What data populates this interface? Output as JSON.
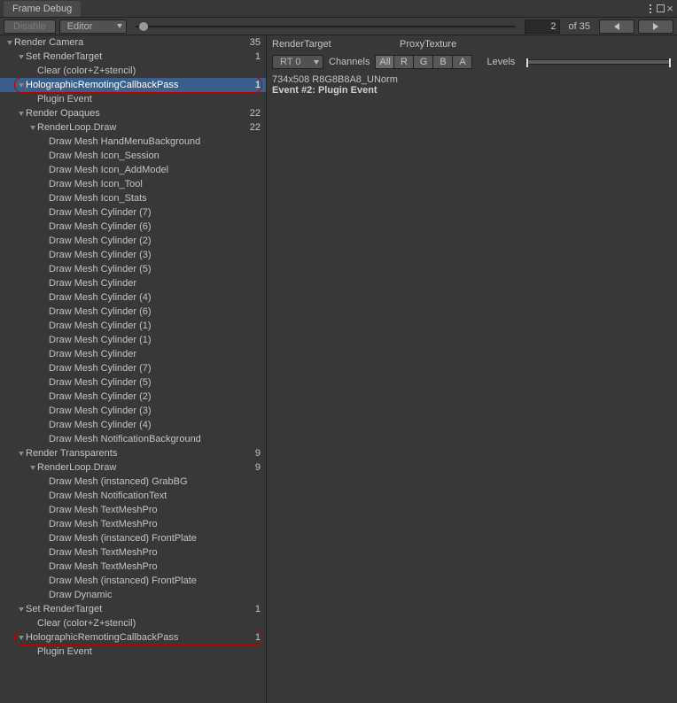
{
  "title": "Frame Debug",
  "toolbar": {
    "disable": "Disable",
    "source": "Editor",
    "index": "2",
    "of_label": "of 35"
  },
  "tree": [
    {
      "d": 0,
      "exp": true,
      "t": "Render Camera",
      "n": "35"
    },
    {
      "d": 1,
      "exp": true,
      "t": "Set RenderTarget",
      "n": "1"
    },
    {
      "d": 2,
      "t": "Clear (color+Z+stencil)"
    },
    {
      "d": 1,
      "exp": true,
      "t": "HolographicRemotingCallbackPass",
      "n": "1",
      "sel": true,
      "circ": true
    },
    {
      "d": 2,
      "t": "Plugin Event"
    },
    {
      "d": 1,
      "exp": true,
      "t": "Render Opaques",
      "n": "22"
    },
    {
      "d": 2,
      "exp": true,
      "t": "RenderLoop.Draw",
      "n": "22"
    },
    {
      "d": 3,
      "t": "Draw Mesh HandMenuBackground"
    },
    {
      "d": 3,
      "t": "Draw Mesh Icon_Session"
    },
    {
      "d": 3,
      "t": "Draw Mesh Icon_AddModel"
    },
    {
      "d": 3,
      "t": "Draw Mesh Icon_Tool"
    },
    {
      "d": 3,
      "t": "Draw Mesh Icon_Stats"
    },
    {
      "d": 3,
      "t": "Draw Mesh Cylinder (7)"
    },
    {
      "d": 3,
      "t": "Draw Mesh Cylinder (6)"
    },
    {
      "d": 3,
      "t": "Draw Mesh Cylinder (2)"
    },
    {
      "d": 3,
      "t": "Draw Mesh Cylinder (3)"
    },
    {
      "d": 3,
      "t": "Draw Mesh Cylinder (5)"
    },
    {
      "d": 3,
      "t": "Draw Mesh Cylinder"
    },
    {
      "d": 3,
      "t": "Draw Mesh Cylinder (4)"
    },
    {
      "d": 3,
      "t": "Draw Mesh Cylinder (6)"
    },
    {
      "d": 3,
      "t": "Draw Mesh Cylinder (1)"
    },
    {
      "d": 3,
      "t": "Draw Mesh Cylinder (1)"
    },
    {
      "d": 3,
      "t": "Draw Mesh Cylinder"
    },
    {
      "d": 3,
      "t": "Draw Mesh Cylinder (7)"
    },
    {
      "d": 3,
      "t": "Draw Mesh Cylinder (5)"
    },
    {
      "d": 3,
      "t": "Draw Mesh Cylinder (2)"
    },
    {
      "d": 3,
      "t": "Draw Mesh Cylinder (3)"
    },
    {
      "d": 3,
      "t": "Draw Mesh Cylinder (4)"
    },
    {
      "d": 3,
      "t": "Draw Mesh NotificationBackground"
    },
    {
      "d": 1,
      "exp": true,
      "t": "Render Transparents",
      "n": "9"
    },
    {
      "d": 2,
      "exp": true,
      "t": "RenderLoop.Draw",
      "n": "9"
    },
    {
      "d": 3,
      "t": "Draw Mesh (instanced) GrabBG"
    },
    {
      "d": 3,
      "t": "Draw Mesh NotificationText"
    },
    {
      "d": 3,
      "t": "Draw Mesh TextMeshPro"
    },
    {
      "d": 3,
      "t": "Draw Mesh TextMeshPro"
    },
    {
      "d": 3,
      "t": "Draw Mesh (instanced) FrontPlate"
    },
    {
      "d": 3,
      "t": "Draw Mesh TextMeshPro"
    },
    {
      "d": 3,
      "t": "Draw Mesh TextMeshPro"
    },
    {
      "d": 3,
      "t": "Draw Mesh (instanced) FrontPlate"
    },
    {
      "d": 3,
      "t": "Draw Dynamic"
    },
    {
      "d": 1,
      "exp": true,
      "t": "Set RenderTarget",
      "n": "1"
    },
    {
      "d": 2,
      "t": "Clear (color+Z+stencil)"
    },
    {
      "d": 1,
      "exp": true,
      "t": "HolographicRemotingCallbackPass",
      "n": "1",
      "circ": true
    },
    {
      "d": 2,
      "t": "Plugin Event"
    }
  ],
  "right": {
    "renderTargetLabel": "RenderTarget",
    "renderTargetValue": "ProxyTexture",
    "rt": "RT 0",
    "channelsLabel": "Channels",
    "channels": [
      "All",
      "R",
      "G",
      "B",
      "A"
    ],
    "levelsLabel": "Levels",
    "dims": "734x508 R8G8B8A8_UNorm",
    "event": "Event #2: Plugin Event"
  }
}
